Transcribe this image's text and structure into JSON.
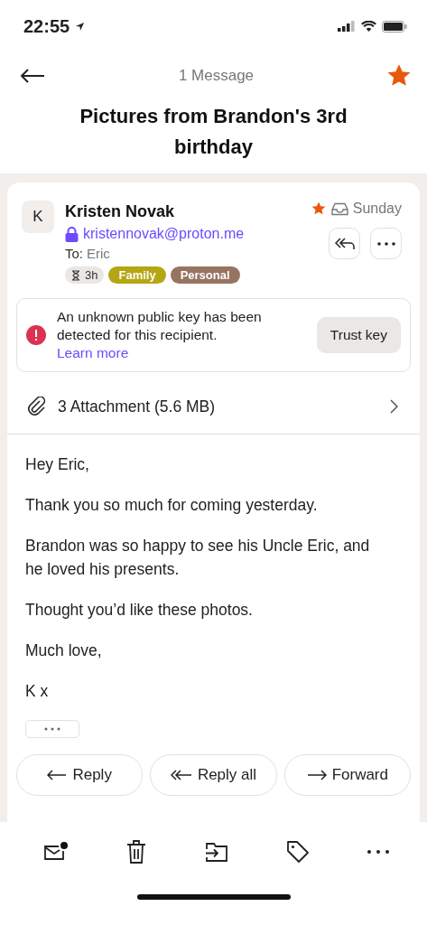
{
  "status_bar": {
    "time": "22:55"
  },
  "header": {
    "subtitle": "1 Message",
    "starred": true,
    "title": "Pictures from Brandon's 3rd birthday"
  },
  "message": {
    "avatar": "K",
    "sender": "Kristen Novak",
    "starred": true,
    "date": "Sunday",
    "email": "kristennovak@proton.me",
    "to_label": "To:",
    "to": "Eric",
    "expiry": "3h",
    "tags": [
      {
        "label": "Family",
        "color": "#b5a614"
      },
      {
        "label": "Personal",
        "color": "#977462"
      }
    ]
  },
  "banner": {
    "text": "An unknown public key has been detected for this recipient.",
    "link": "Learn more",
    "button": "Trust key"
  },
  "attachments": {
    "label": "3 Attachment (5.6 MB)"
  },
  "body": [
    "Hey Eric,",
    "Thank you so much for coming yesterday.",
    "Brandon was so happy to see his Uncle Eric, and he loved his presents.",
    "Thought you’d like these photos.",
    "Much love,",
    "K x"
  ],
  "actions": [
    {
      "kind": "reply",
      "label": "Reply"
    },
    {
      "kind": "reply_all",
      "label": "Reply all"
    },
    {
      "kind": "forward",
      "label": "Forward"
    }
  ],
  "toolbar": [
    {
      "kind": "unread"
    },
    {
      "kind": "trash"
    },
    {
      "kind": "move"
    },
    {
      "kind": "label"
    },
    {
      "kind": "more"
    }
  ]
}
